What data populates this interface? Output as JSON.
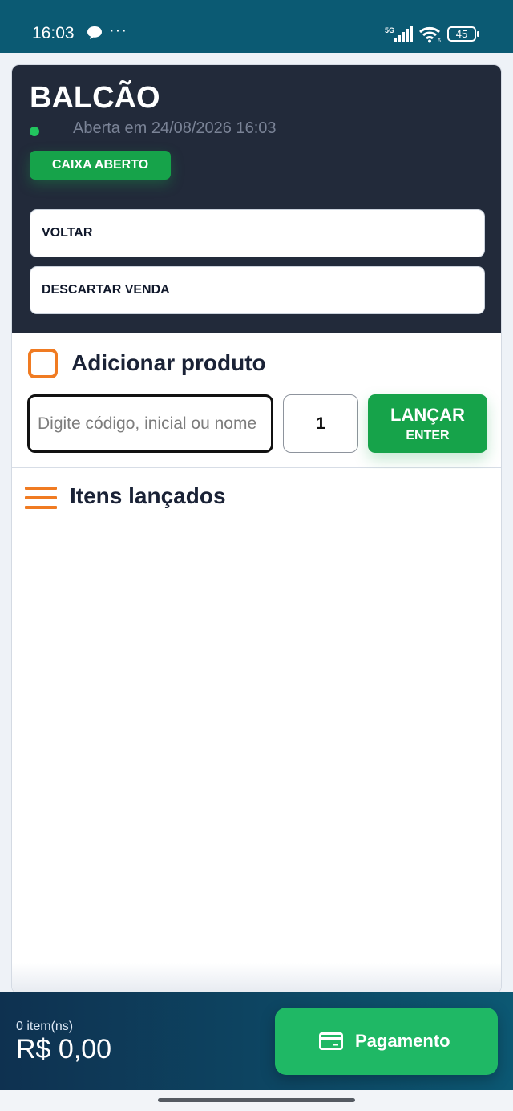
{
  "status_bar": {
    "time": "16:03",
    "more": "···",
    "network": "5G",
    "wifi_sub": "6",
    "battery": "45"
  },
  "header": {
    "title": "BALCÃO",
    "opened_at": "Aberta em 24/08/2026 16:03",
    "badge": "CAIXA ABERTO",
    "back_button": "VOLTAR",
    "discard_button": "DESCARTAR VENDA"
  },
  "add_product": {
    "title": "Adicionar produto",
    "search_placeholder": "Digite código, inicial ou nome",
    "quantity": "1",
    "launch_label": "LANÇAR",
    "launch_shortcut": "ENTER"
  },
  "items": {
    "title": "Itens lançados",
    "list": []
  },
  "footer": {
    "item_count": "0 item(ns)",
    "total": "R$ 0,00",
    "pay_label": "Pagamento"
  },
  "colors": {
    "status_bar": "#0b5a73",
    "header_bg": "#222a3a",
    "accent_green": "#16a34a",
    "accent_orange": "#f07b22",
    "footer_bg": "#0e3150"
  },
  "icons": {
    "chat": "chat-bubble-icon",
    "signal": "cell-signal-icon",
    "wifi": "wifi-icon",
    "battery": "battery-icon",
    "add_product": "checkbox-icon",
    "items": "menu-icon",
    "payment": "credit-card-icon"
  }
}
